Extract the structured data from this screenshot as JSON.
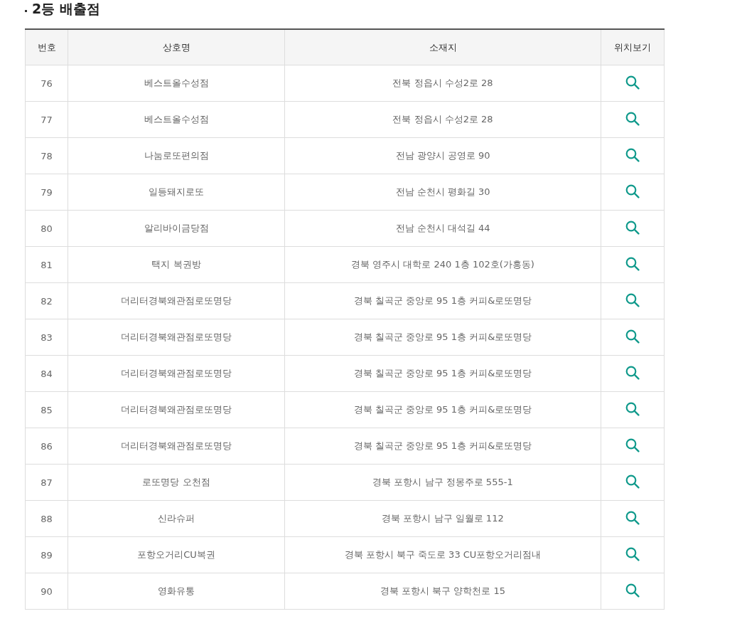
{
  "section_title": "2등 배출점",
  "table": {
    "columns": [
      "번호",
      "상호명",
      "소재지",
      "위치보기"
    ],
    "rows": [
      {
        "no": "76",
        "name": "베스트올수성점",
        "address": "전북 정읍시 수성2로 28"
      },
      {
        "no": "77",
        "name": "베스트올수성점",
        "address": "전북 정읍시 수성2로 28"
      },
      {
        "no": "78",
        "name": "나눔로또편의점",
        "address": "전남 광양시 공영로 90"
      },
      {
        "no": "79",
        "name": "일등돼지로또",
        "address": "전남 순천시 평화길 30"
      },
      {
        "no": "80",
        "name": "알리바이금당점",
        "address": "전남 순천시 대석길 44"
      },
      {
        "no": "81",
        "name": "택지 복권방",
        "address": "경북 영주시 대학로 240 1층 102호(가흥동)"
      },
      {
        "no": "82",
        "name": "더리터경북왜관점로또명당",
        "address": "경북 칠곡군 중앙로 95 1층 커피&로또명당"
      },
      {
        "no": "83",
        "name": "더리터경북왜관점로또명당",
        "address": "경북 칠곡군 중앙로 95 1층 커피&로또명당"
      },
      {
        "no": "84",
        "name": "더리터경북왜관점로또명당",
        "address": "경북 칠곡군 중앙로 95 1층 커피&로또명당"
      },
      {
        "no": "85",
        "name": "더리터경북왜관점로또명당",
        "address": "경북 칠곡군 중앙로 95 1층 커피&로또명당"
      },
      {
        "no": "86",
        "name": "더리터경북왜관점로또명당",
        "address": "경북 칠곡군 중앙로 95 1층 커피&로또명당"
      },
      {
        "no": "87",
        "name": "로또명당 오천점",
        "address": "경북 포항시 남구 정몽주로 555-1"
      },
      {
        "no": "88",
        "name": "신라슈퍼",
        "address": "경북 포항시 남구 일월로 112"
      },
      {
        "no": "89",
        "name": "포항오거리CU복권",
        "address": "경북 포항시 북구 죽도로 33 CU포항오거리점내"
      },
      {
        "no": "90",
        "name": "영화유통",
        "address": "경북 포항시 북구 양학천로 15"
      }
    ]
  }
}
